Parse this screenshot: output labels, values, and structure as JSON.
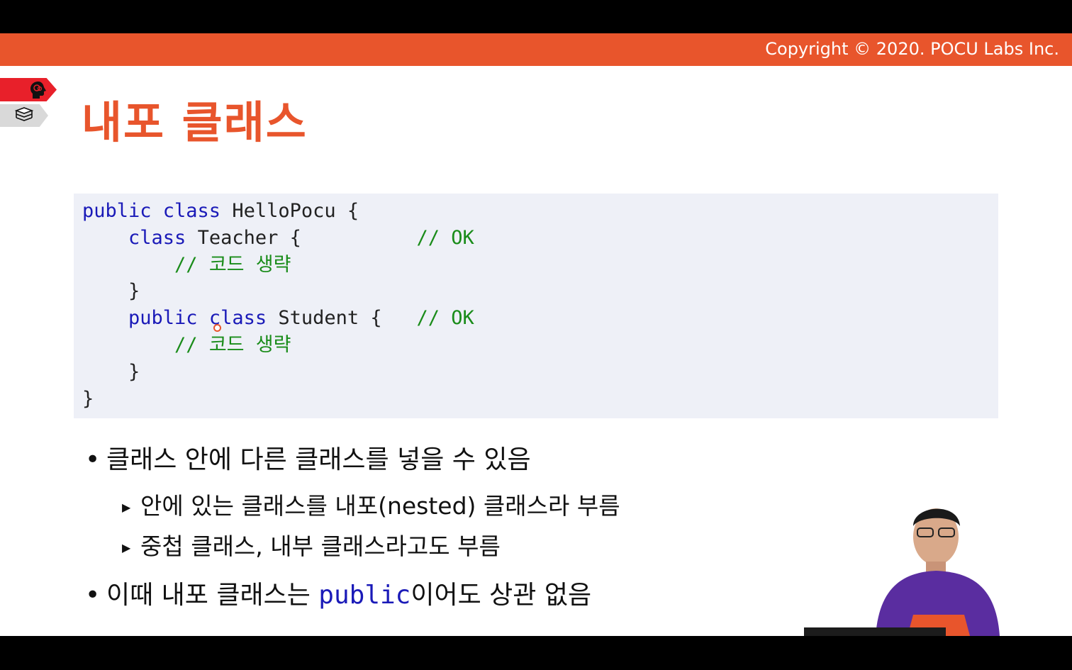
{
  "header": {
    "copyright": "Copyright © 2020. POCU Labs Inc."
  },
  "slide": {
    "title": "내포 클래스"
  },
  "code": {
    "lines": [
      [
        {
          "t": "public class ",
          "k": "kw"
        },
        {
          "t": "HelloPocu {",
          "k": ""
        }
      ],
      [
        {
          "t": "    ",
          "k": ""
        },
        {
          "t": "class ",
          "k": "kw"
        },
        {
          "t": "Teacher {          ",
          "k": ""
        },
        {
          "t": "// OK",
          "k": "cm"
        }
      ],
      [
        {
          "t": "        ",
          "k": ""
        },
        {
          "t": "// 코드 생략",
          "k": "cm"
        }
      ],
      [
        {
          "t": "    }",
          "k": ""
        }
      ],
      [
        {
          "t": "    ",
          "k": ""
        },
        {
          "t": "public class ",
          "k": "kw"
        },
        {
          "t": "Student {   ",
          "k": ""
        },
        {
          "t": "// OK",
          "k": "cm"
        }
      ],
      [
        {
          "t": "        ",
          "k": ""
        },
        {
          "t": "// 코드 생략",
          "k": "cm"
        }
      ],
      [
        {
          "t": "    }",
          "k": ""
        }
      ],
      [
        {
          "t": "}",
          "k": ""
        }
      ]
    ]
  },
  "bullets": {
    "b1": "클래스 안에 다른 클래스를 넣을 수 있음",
    "b1_sub1": "안에 있는 클래스를 내포(nested) 클래스라 부름",
    "b1_sub2": "중첩 클래스, 내부 클래스라고도 부름",
    "b2_prefix": "이때 내포 클래스는 ",
    "b2_code": "public",
    "b2_suffix": "이어도 상관 없음"
  },
  "icons": {
    "brain": "brain-head-icon",
    "books": "book-stack-icon"
  },
  "colors": {
    "accent": "#e8552c",
    "keyword": "#1a1ab8",
    "comment": "#1a8c1a",
    "code_bg": "#eef0f7"
  }
}
